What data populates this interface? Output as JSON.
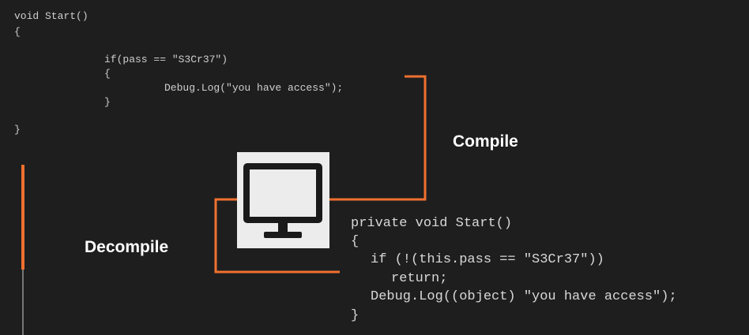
{
  "source_code": {
    "lines": [
      "void Start()",
      "{",
      "if(pass == \"S3Cr37\")",
      "{",
      "Debug.Log(\"you have access\");",
      "}",
      "}"
    ]
  },
  "decompiled_code": {
    "lines": [
      "private void Start()",
      "{",
      "if (!(this.pass == \"S3Cr37\"))",
      "return;",
      "Debug.Log((object) \"you have access\");",
      "}"
    ]
  },
  "labels": {
    "compile": "Compile",
    "decompile": "Decompile"
  },
  "icons": {
    "computer": "computer-monitor-icon"
  },
  "colors": {
    "background": "#1e1e1e",
    "accent": "#f07030",
    "icon_box": "#ececec",
    "icon": "#1a1a1a"
  }
}
